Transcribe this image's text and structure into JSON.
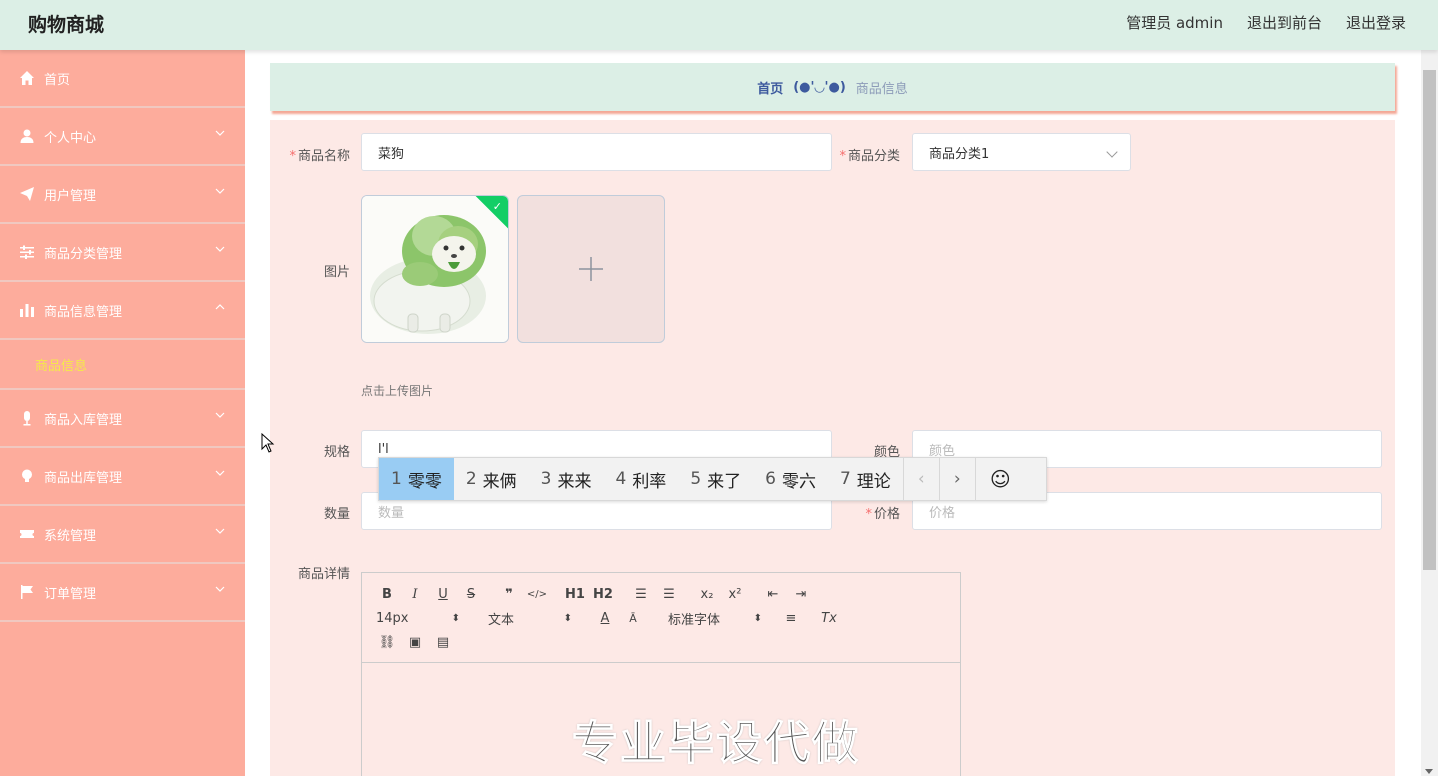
{
  "header": {
    "brand": "购物商城",
    "admin": "管理员 admin",
    "front": "退出到前台",
    "logout": "退出登录"
  },
  "sidebar": {
    "items": [
      {
        "label": "首页",
        "icon": "home-icon"
      },
      {
        "label": "个人中心",
        "icon": "user-icon"
      },
      {
        "label": "用户管理",
        "icon": "send-icon"
      },
      {
        "label": "商品分类管理",
        "icon": "sliders-icon"
      },
      {
        "label": "商品信息管理",
        "icon": "bar-chart-icon"
      },
      {
        "label": "商品入库管理",
        "icon": "microphone-icon"
      },
      {
        "label": "商品出库管理",
        "icon": "bulb-icon"
      },
      {
        "label": "系统管理",
        "icon": "ticket-icon"
      },
      {
        "label": "订单管理",
        "icon": "flag-icon"
      }
    ],
    "subitem": "商品信息"
  },
  "breadcrumb": {
    "home": "首页",
    "separator": "(●'◡'●)",
    "current": "商品信息"
  },
  "form": {
    "name_label": "商品名称",
    "name_value": "菜狗",
    "category_label": "商品分类",
    "category_value": "商品分类1",
    "image_label": "图片",
    "upload_tip": "点击上传图片",
    "spec_label": "规格",
    "spec_value": "l'l",
    "color_label": "颜色",
    "color_placeholder": "颜色",
    "quantity_label": "数量",
    "quantity_placeholder": "数量",
    "price_label": "价格",
    "price_placeholder": "价格",
    "detail_label": "商品详情"
  },
  "ime": {
    "candidates": [
      {
        "num": "1",
        "text": "零零"
      },
      {
        "num": "2",
        "text": "来俩"
      },
      {
        "num": "3",
        "text": "来来"
      },
      {
        "num": "4",
        "text": "利率"
      },
      {
        "num": "5",
        "text": "来了"
      },
      {
        "num": "6",
        "text": "零六"
      },
      {
        "num": "7",
        "text": "理论"
      }
    ],
    "prev": "‹",
    "next": "›",
    "emoji": "☺"
  },
  "editor": {
    "font_size": "14px",
    "block_type": "文本",
    "font_family": "标准字体",
    "content": "专业毕设代做",
    "h1": "H1",
    "h2": "H2"
  },
  "colors": {
    "header_bg": "#dcefe6",
    "sidebar_bg": "#fdac9c",
    "panel_bg": "#fde9e6",
    "active_sub": "#f5e94a",
    "ime_active": "#99ccf3"
  }
}
